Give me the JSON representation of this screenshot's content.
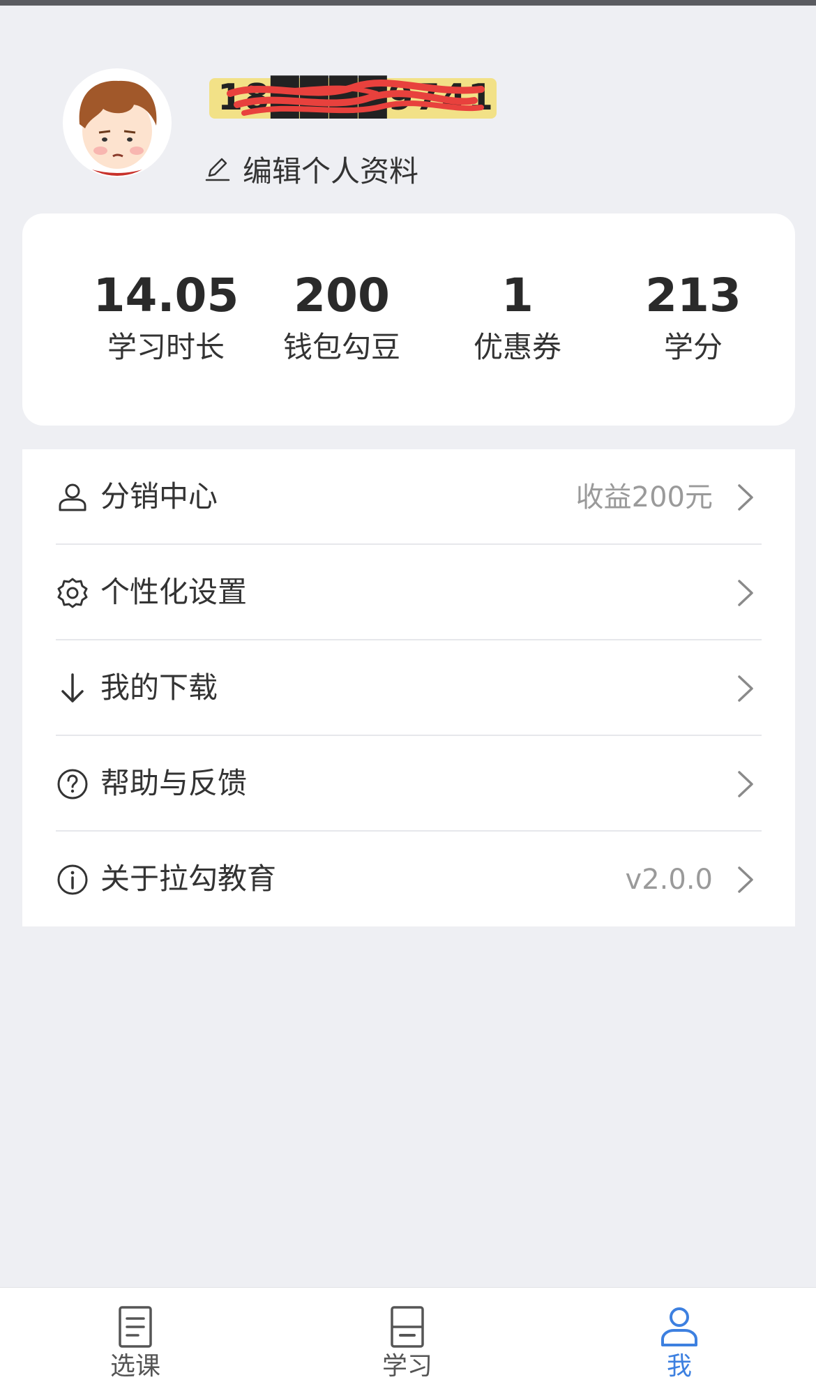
{
  "profile": {
    "username": "18████9741",
    "edit_label": "编辑个人资料"
  },
  "stats": [
    {
      "value": "14.05",
      "label": "学习时长"
    },
    {
      "value": "200",
      "label": "钱包勾豆"
    },
    {
      "value": "1",
      "label": "优惠券"
    },
    {
      "value": "213",
      "label": "学分"
    }
  ],
  "menu": [
    {
      "icon": "user-icon",
      "label": "分销中心",
      "extra": "收益200元"
    },
    {
      "icon": "gear-icon",
      "label": "个性化设置",
      "extra": ""
    },
    {
      "icon": "download-icon",
      "label": "我的下载",
      "extra": ""
    },
    {
      "icon": "help-icon",
      "label": "帮助与反馈",
      "extra": ""
    },
    {
      "icon": "info-icon",
      "label": "关于拉勾教育",
      "extra": "v2.0.0"
    }
  ],
  "tabs": [
    {
      "icon": "document-icon",
      "label": "选课"
    },
    {
      "icon": "study-icon",
      "label": "学习"
    },
    {
      "icon": "person-icon",
      "label": "我",
      "active": true
    }
  ],
  "colors": {
    "background": "#eeeff3",
    "accent": "#3d80e0",
    "secondary_text": "#9a9a9a",
    "highlight": "#f3dc63",
    "redaction": "#e8413d"
  }
}
